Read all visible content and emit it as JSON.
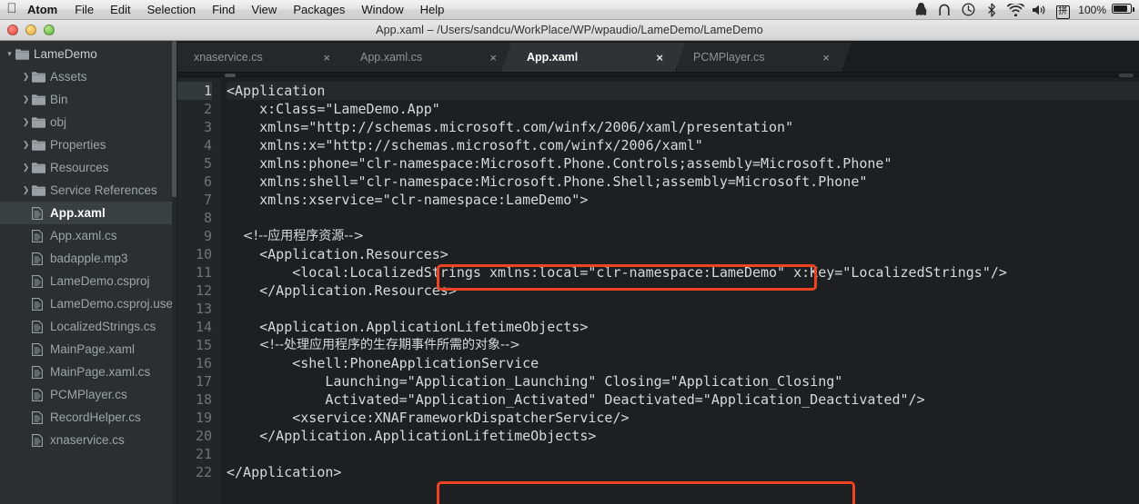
{
  "menubar": {
    "apple_icon": "apple-logo",
    "items": [
      {
        "label": "Atom",
        "bold": true
      },
      {
        "label": "File"
      },
      {
        "label": "Edit"
      },
      {
        "label": "Selection"
      },
      {
        "label": "Find"
      },
      {
        "label": "View"
      },
      {
        "label": "Packages"
      },
      {
        "label": "Window"
      },
      {
        "label": "Help"
      }
    ],
    "status": {
      "qq_icon": "qq-penguin-icon",
      "dropbox_icon": "dropbox-icon",
      "timemachine_icon": "time-machine-clock-icon",
      "bluetooth_icon": "bluetooth-icon",
      "wifi_icon": "wifi-icon",
      "volume_icon": "volume-icon",
      "input_method_icon": "input-method-icon",
      "input_method_label": "拼",
      "battery_percent": "100%",
      "battery_icon": "battery-icon"
    }
  },
  "window": {
    "title": "App.xaml – /Users/sandcu/WorkPlace/WP/wpaudio/LameDemo/LameDemo",
    "close_label": "",
    "minimize_label": "",
    "zoom_label": ""
  },
  "sidebar": {
    "items": [
      {
        "label": "LameDemo",
        "type": "folder",
        "depth": 0,
        "expanded": true,
        "selected": false
      },
      {
        "label": "Assets",
        "type": "folder",
        "depth": 1,
        "expanded": false,
        "selected": false
      },
      {
        "label": "Bin",
        "type": "folder",
        "depth": 1,
        "expanded": false,
        "selected": false
      },
      {
        "label": "obj",
        "type": "folder",
        "depth": 1,
        "expanded": false,
        "selected": false
      },
      {
        "label": "Properties",
        "type": "folder",
        "depth": 1,
        "expanded": false,
        "selected": false
      },
      {
        "label": "Resources",
        "type": "folder",
        "depth": 1,
        "expanded": false,
        "selected": false
      },
      {
        "label": "Service References",
        "type": "folder",
        "depth": 1,
        "expanded": false,
        "selected": false
      },
      {
        "label": "App.xaml",
        "type": "file",
        "depth": 1,
        "expanded": false,
        "selected": true
      },
      {
        "label": "App.xaml.cs",
        "type": "file",
        "depth": 1,
        "expanded": false,
        "selected": false
      },
      {
        "label": "badapple.mp3",
        "type": "file",
        "depth": 1,
        "expanded": false,
        "selected": false
      },
      {
        "label": "LameDemo.csproj",
        "type": "file",
        "depth": 1,
        "expanded": false,
        "selected": false
      },
      {
        "label": "LameDemo.csproj.use",
        "type": "file",
        "depth": 1,
        "expanded": false,
        "selected": false
      },
      {
        "label": "LocalizedStrings.cs",
        "type": "file",
        "depth": 1,
        "expanded": false,
        "selected": false
      },
      {
        "label": "MainPage.xaml",
        "type": "file",
        "depth": 1,
        "expanded": false,
        "selected": false
      },
      {
        "label": "MainPage.xaml.cs",
        "type": "file",
        "depth": 1,
        "expanded": false,
        "selected": false
      },
      {
        "label": "PCMPlayer.cs",
        "type": "file",
        "depth": 1,
        "expanded": false,
        "selected": false
      },
      {
        "label": "RecordHelper.cs",
        "type": "file",
        "depth": 1,
        "expanded": false,
        "selected": false
      },
      {
        "label": "xnaservice.cs",
        "type": "file",
        "depth": 1,
        "expanded": false,
        "selected": false
      }
    ]
  },
  "tabs": [
    {
      "label": "xnaservice.cs",
      "active": false,
      "close": "×"
    },
    {
      "label": "App.xaml.cs",
      "active": false,
      "close": "×"
    },
    {
      "label": "App.xaml",
      "active": true,
      "close": "×"
    },
    {
      "label": "PCMPlayer.cs",
      "active": false,
      "close": "×"
    }
  ],
  "editor": {
    "line_numbers": [
      "1",
      "2",
      "3",
      "4",
      "5",
      "6",
      "7",
      "8",
      "9",
      "10",
      "11",
      "12",
      "13",
      "14",
      "15",
      "16",
      "17",
      "18",
      "19",
      "20",
      "21",
      "22"
    ],
    "current_line": 1,
    "lines": [
      "<Application",
      "    x:Class=\"LameDemo.App\"",
      "    xmlns=\"http://schemas.microsoft.com/winfx/2006/xaml/presentation\"",
      "    xmlns:x=\"http://schemas.microsoft.com/winfx/2006/xaml\"",
      "    xmlns:phone=\"clr-namespace:Microsoft.Phone.Controls;assembly=Microsoft.Phone\"",
      "    xmlns:shell=\"clr-namespace:Microsoft.Phone.Shell;assembly=Microsoft.Phone\"",
      "    xmlns:xservice=\"clr-namespace:LameDemo\">",
      "",
      "    <!--应用程序资源-->",
      "    <Application.Resources>",
      "        <local:LocalizedStrings xmlns:local=\"clr-namespace:LameDemo\" x:Key=\"LocalizedStrings\"/>",
      "    </Application.Resources>",
      "",
      "    <Application.ApplicationLifetimeObjects>",
      "        <!--处理应用程序的生存期事件所需的对象-->",
      "        <shell:PhoneApplicationService",
      "            Launching=\"Application_Launching\" Closing=\"Application_Closing\"",
      "            Activated=\"Application_Activated\" Deactivated=\"Application_Deactivated\"/>",
      "        <xservice:XNAFrameworkDispatcherService/>",
      "    </Application.ApplicationLifetimeObjects>",
      "",
      "</Application>"
    ]
  },
  "annotations": [
    {
      "name": "highlight-box-xmlns-xservice",
      "target_line": 7,
      "color": "#ef4422"
    },
    {
      "name": "highlight-box-dispatcher-service",
      "target_line": 19,
      "color": "#ef4422"
    }
  ],
  "colors": {
    "annotation_red": "#ef4422",
    "editor_bg": "#1d1f21",
    "sidebar_bg": "#2b2f31",
    "tab_active_bg": "#2f3335",
    "text": "#d7dadc"
  }
}
